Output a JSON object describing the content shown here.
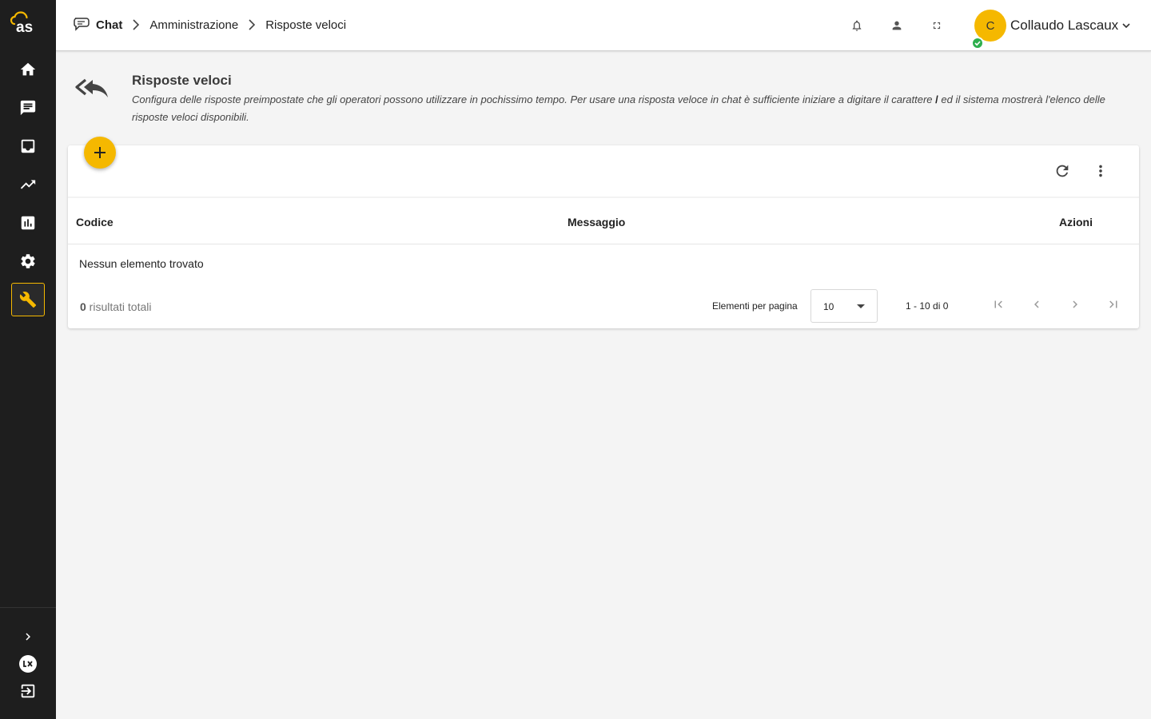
{
  "app": {
    "logo_text": "as"
  },
  "sidebar": {
    "items": [
      {
        "icon": "home-icon"
      },
      {
        "icon": "chat-icon"
      },
      {
        "icon": "inbox-icon"
      },
      {
        "icon": "trending-up-icon"
      },
      {
        "icon": "bar-chart-icon"
      },
      {
        "icon": "settings-gear-icon"
      },
      {
        "icon": "wrench-icon",
        "active": true
      }
    ],
    "bottom": [
      {
        "icon": "chevron-right-icon"
      },
      {
        "icon": "lx-brand-icon"
      },
      {
        "icon": "logout-icon"
      }
    ]
  },
  "header": {
    "breadcrumbs": [
      "Chat",
      "Amministrazione",
      "Risposte veloci"
    ],
    "user": {
      "initial": "C",
      "name": "Collaudo Lascaux",
      "status": "online"
    }
  },
  "page": {
    "title": "Risposte veloci",
    "description_1": "Configura delle risposte preimpostate che gli operatori possono utilizzare in pochissimo tempo. Per usare una risposta veloce in chat è sufficiente iniziare a digitare il carattere ",
    "description_slash": "/",
    "description_2": " ed il sistema mostrerà l'elenco delle risposte veloci disponibili."
  },
  "table": {
    "columns": [
      "Codice",
      "Messaggio",
      "Azioni"
    ],
    "empty_message": "Nessun elemento trovato",
    "total_count": "0",
    "total_label": " risultati totali",
    "per_page_label": "Elementi per pagina",
    "per_page_value": "10",
    "range_label": "1 - 10 di 0"
  },
  "colors": {
    "accent": "#f5b800",
    "sidebar_bg": "#1e1e1e",
    "status_online": "#2eaf4e"
  }
}
